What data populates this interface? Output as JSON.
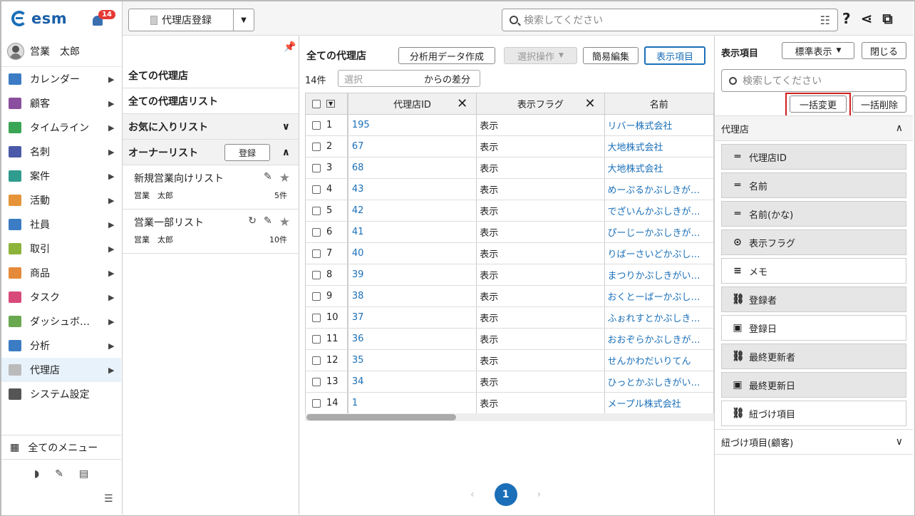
{
  "app": {
    "logo": "esm",
    "notifications": "14",
    "user": "営業　太郎"
  },
  "sidebar": {
    "items": [
      {
        "label": "カレンダー",
        "icon": "calendar-icon",
        "color": "#3b7cc4"
      },
      {
        "label": "顧客",
        "icon": "building-icon",
        "color": "#8a4f9e"
      },
      {
        "label": "タイムライン",
        "icon": "chat-icon",
        "color": "#3aa655"
      },
      {
        "label": "名刺",
        "icon": "card-icon",
        "color": "#4a5aa8"
      },
      {
        "label": "案件",
        "icon": "folder-icon",
        "color": "#2f9c8e"
      },
      {
        "label": "活動",
        "icon": "clipboard-icon",
        "color": "#e5943a"
      },
      {
        "label": "社員",
        "icon": "person-icon",
        "color": "#3b7cc4"
      },
      {
        "label": "取引",
        "icon": "book-icon",
        "color": "#8db33a"
      },
      {
        "label": "商品",
        "icon": "box-icon",
        "color": "#e58a3a"
      },
      {
        "label": "タスク",
        "icon": "check-icon",
        "color": "#d84a7a"
      },
      {
        "label": "ダッシュボ…",
        "icon": "dashboard-icon",
        "color": "#6aa84f"
      },
      {
        "label": "分析",
        "icon": "chart-icon",
        "color": "#3b7cc4"
      },
      {
        "label": "代理店",
        "icon": "doc-icon",
        "color": "#bbbbbb"
      },
      {
        "label": "システム設定",
        "icon": "gear-icon",
        "color": "#555555"
      }
    ],
    "all_menu": "全てのメニュー"
  },
  "topbar": {
    "register": "代理店登録",
    "search_placeholder": "検索してください"
  },
  "lists": {
    "all": "全ての代理店",
    "all_list": "全ての代理店リスト",
    "favorites": "お気に入りリスト",
    "owner": "オーナーリスト",
    "register": "登録",
    "fav_items": [
      {
        "name": "新規営業向けリスト",
        "owner": "営業　太郎",
        "count": "5件"
      },
      {
        "name": "営業一部リスト",
        "owner": "営業　太郎",
        "count": "10件"
      }
    ]
  },
  "main": {
    "title": "全ての代理店",
    "btn_analysis": "分析用データ作成",
    "btn_select": "選択操作",
    "btn_edit": "簡易編集",
    "btn_display": "表示項目",
    "count": "14件",
    "select_placeholder": "選択",
    "diff": "からの差分",
    "columns": [
      "代理店ID",
      "表示フラグ",
      "名前"
    ],
    "rows": [
      {
        "n": "1",
        "id": "195",
        "flag": "表示",
        "name": "リバー株式会社"
      },
      {
        "n": "2",
        "id": "67",
        "flag": "表示",
        "name": "大地株式会社"
      },
      {
        "n": "3",
        "id": "68",
        "flag": "表示",
        "name": "大地株式会社"
      },
      {
        "n": "4",
        "id": "43",
        "flag": "表示",
        "name": "めーぷるかぶしきが…"
      },
      {
        "n": "5",
        "id": "42",
        "flag": "表示",
        "name": "でざいんかぶしきが…"
      },
      {
        "n": "6",
        "id": "41",
        "flag": "表示",
        "name": "ぴーじーかぶしきが…"
      },
      {
        "n": "7",
        "id": "40",
        "flag": "表示",
        "name": "りばーさいどかぶし…"
      },
      {
        "n": "8",
        "id": "39",
        "flag": "表示",
        "name": "まつりかぶしきがい…"
      },
      {
        "n": "9",
        "id": "38",
        "flag": "表示",
        "name": "おくとーばーかぶし…"
      },
      {
        "n": "10",
        "id": "37",
        "flag": "表示",
        "name": "ふぉれすとかぶしき…"
      },
      {
        "n": "11",
        "id": "36",
        "flag": "表示",
        "name": "おおぞらかぶしきが…"
      },
      {
        "n": "12",
        "id": "35",
        "flag": "表示",
        "name": "せんかわだいりてん"
      },
      {
        "n": "13",
        "id": "34",
        "flag": "表示",
        "name": "ひっとかぶしきがい…"
      },
      {
        "n": "14",
        "id": "1",
        "flag": "表示",
        "name": "メープル株式会社"
      }
    ],
    "page": "1"
  },
  "rpanel": {
    "title": "表示項目",
    "standard": "標準表示",
    "close": "閉じる",
    "search_placeholder": "検索してください",
    "bulk_change": "一括変更",
    "bulk_delete": "一括削除",
    "section": "代理店",
    "section2": "紐づけ項目(顧客)",
    "fields": [
      {
        "label": "代理店ID",
        "icon": "text-icon",
        "glyph": "═",
        "active": true
      },
      {
        "label": "名前",
        "icon": "text-icon",
        "glyph": "═",
        "active": true
      },
      {
        "label": "名前(かな)",
        "icon": "text-icon",
        "glyph": "═",
        "active": true
      },
      {
        "label": "表示フラグ",
        "icon": "dropdown-icon",
        "glyph": "⊙",
        "active": true
      },
      {
        "label": "メモ",
        "icon": "multiline-icon",
        "glyph": "≡",
        "active": false
      },
      {
        "label": "登録者",
        "icon": "link-icon",
        "glyph": "⛓",
        "active": true
      },
      {
        "label": "登録日",
        "icon": "calendar-icon",
        "glyph": "▣",
        "active": false
      },
      {
        "label": "最終更新者",
        "icon": "link-icon",
        "glyph": "⛓",
        "active": true
      },
      {
        "label": "最終更新日",
        "icon": "calendar-icon",
        "glyph": "▣",
        "active": true
      },
      {
        "label": "紐づけ項目",
        "icon": "link-icon",
        "glyph": "⛓",
        "active": false
      }
    ]
  }
}
